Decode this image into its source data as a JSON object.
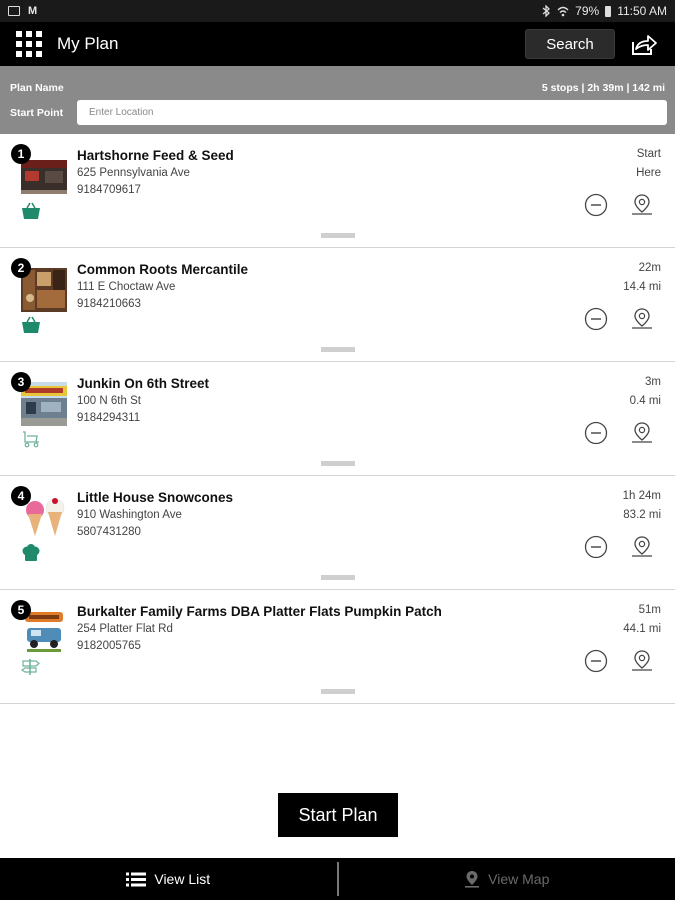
{
  "status_bar": {
    "battery": "79%",
    "time": "11:50 AM",
    "left_icons": [
      "gallery-icon",
      "gmail-icon"
    ],
    "right_icons": [
      "bluetooth-icon",
      "wifi-icon",
      "battery-icon"
    ]
  },
  "app_bar": {
    "title": "My Plan",
    "search_label": "Search",
    "menu_icon": "grid-menu-icon",
    "share_icon": "share-icon"
  },
  "plan": {
    "name_label": "Plan Name",
    "summary": "5 stops | 2h 39m | 142 mi",
    "start_label": "Start Point",
    "start_placeholder": "Enter Location"
  },
  "stops": [
    {
      "num": "1",
      "name": "Hartshorne Feed & Seed",
      "address": "625 Pennsylvania Ave",
      "phone": "9184709617",
      "t1": "Start",
      "t2": "Here",
      "category": "shopping-basket-icon"
    },
    {
      "num": "2",
      "name": "Common Roots Mercantile",
      "address": "111 E Choctaw Ave",
      "phone": "9184210663",
      "t1": "22m",
      "t2": "14.4 mi",
      "category": "shopping-basket-icon"
    },
    {
      "num": "3",
      "name": "Junkin On 6th Street",
      "address": "100 N 6th St",
      "phone": "9184294311",
      "t1": "3m",
      "t2": "0.4 mi",
      "category": "antiques-icon"
    },
    {
      "num": "4",
      "name": "Little House Snowcones",
      "address": "910 Washington Ave",
      "phone": "5807431280",
      "t1": "1h 24m",
      "t2": "83.2 mi",
      "category": "food-icon"
    },
    {
      "num": "5",
      "name": "Burkalter Family Farms DBA Platter Flats Pumpkin Patch",
      "address": "254 Platter Flat Rd",
      "phone": "9182005765",
      "t1": "51m",
      "t2": "44.1 mi",
      "category": "signpost-icon"
    }
  ],
  "actions": {
    "start_plan": "Start Plan"
  },
  "tabs": [
    {
      "label": "View List",
      "active": true
    },
    {
      "label": "View Map",
      "active": false
    }
  ],
  "colors": {
    "accent_green": "#1f8a6b",
    "bar_black": "#000000",
    "header_gray": "#8a8a8a"
  }
}
